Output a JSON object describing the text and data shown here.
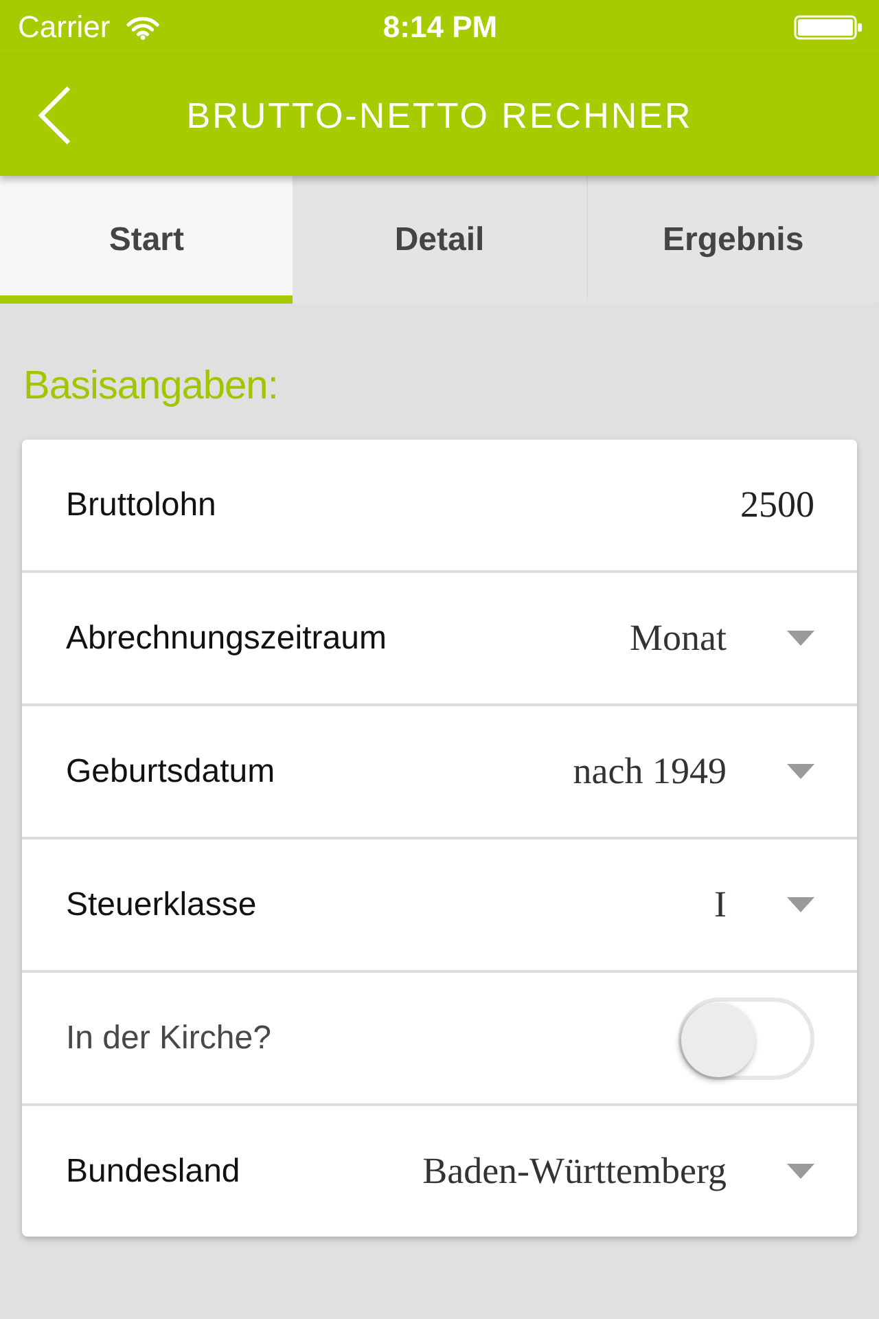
{
  "status_bar": {
    "carrier": "Carrier",
    "time": "8:14 PM"
  },
  "header": {
    "title": "BRUTTO-NETTO RECHNER"
  },
  "tabs": [
    {
      "label": "Start",
      "selected": true
    },
    {
      "label": "Detail",
      "selected": false
    },
    {
      "label": "Ergebnis",
      "selected": false
    }
  ],
  "form": {
    "heading": "Basisangaben:",
    "fields": [
      {
        "kind": "input",
        "label": "Bruttolohn",
        "value": "2500"
      },
      {
        "kind": "select",
        "label": "Abrechnungszeitraum",
        "value": "Monat"
      },
      {
        "kind": "select",
        "label": "Geburtsdatum",
        "value": "nach 1949"
      },
      {
        "kind": "select",
        "label": "Steuerklasse",
        "value": "I"
      },
      {
        "kind": "toggle",
        "label": "In der Kirche?",
        "on": false
      },
      {
        "kind": "select",
        "label": "Bundesland",
        "value": "Baden-Württemberg"
      }
    ]
  }
}
